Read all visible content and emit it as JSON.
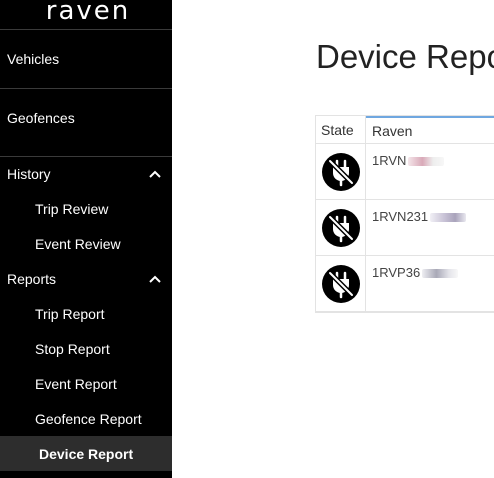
{
  "brand": {
    "logo_text": "raven"
  },
  "sidebar": {
    "vehicles": "Vehicles",
    "geofences": "Geofences",
    "history": {
      "label": "History",
      "items": [
        "Trip Review",
        "Event Review"
      ]
    },
    "reports": {
      "label": "Reports",
      "items": [
        "Trip Report",
        "Stop Report",
        "Event Report",
        "Geofence Report",
        "Device Report"
      ],
      "active": "Device Report"
    }
  },
  "main": {
    "title": "Device Repo",
    "table": {
      "columns": [
        "State",
        "Raven"
      ],
      "rows": [
        {
          "state_icon": "unplugged-icon",
          "raven": "1RVN",
          "blur_color": "#d9a9b8"
        },
        {
          "state_icon": "unplugged-icon",
          "raven": "1RVN231",
          "blur_color": "#b7b0c6"
        },
        {
          "state_icon": "unplugged-icon",
          "raven": "1RVP36",
          "blur_color": "#a9a9b7"
        }
      ]
    }
  },
  "colors": {
    "sidebar_bg": "#000000",
    "active_item_bg": "#2d2d2d",
    "header_accent": "#6fa7e0"
  }
}
